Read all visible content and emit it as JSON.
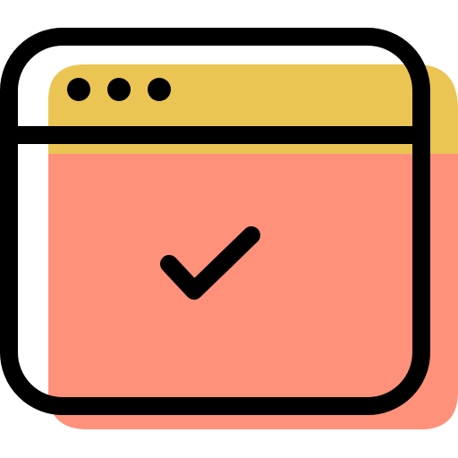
{
  "icon": {
    "name": "browser-window-check-icon",
    "colors": {
      "outline": "#000000",
      "titlebar_fill": "#EBC553",
      "content_fill": "#FF917B",
      "background": "#FFFFFF"
    },
    "window_controls": {
      "dot_count": 3
    },
    "status_glyph": "check-mark-icon"
  }
}
